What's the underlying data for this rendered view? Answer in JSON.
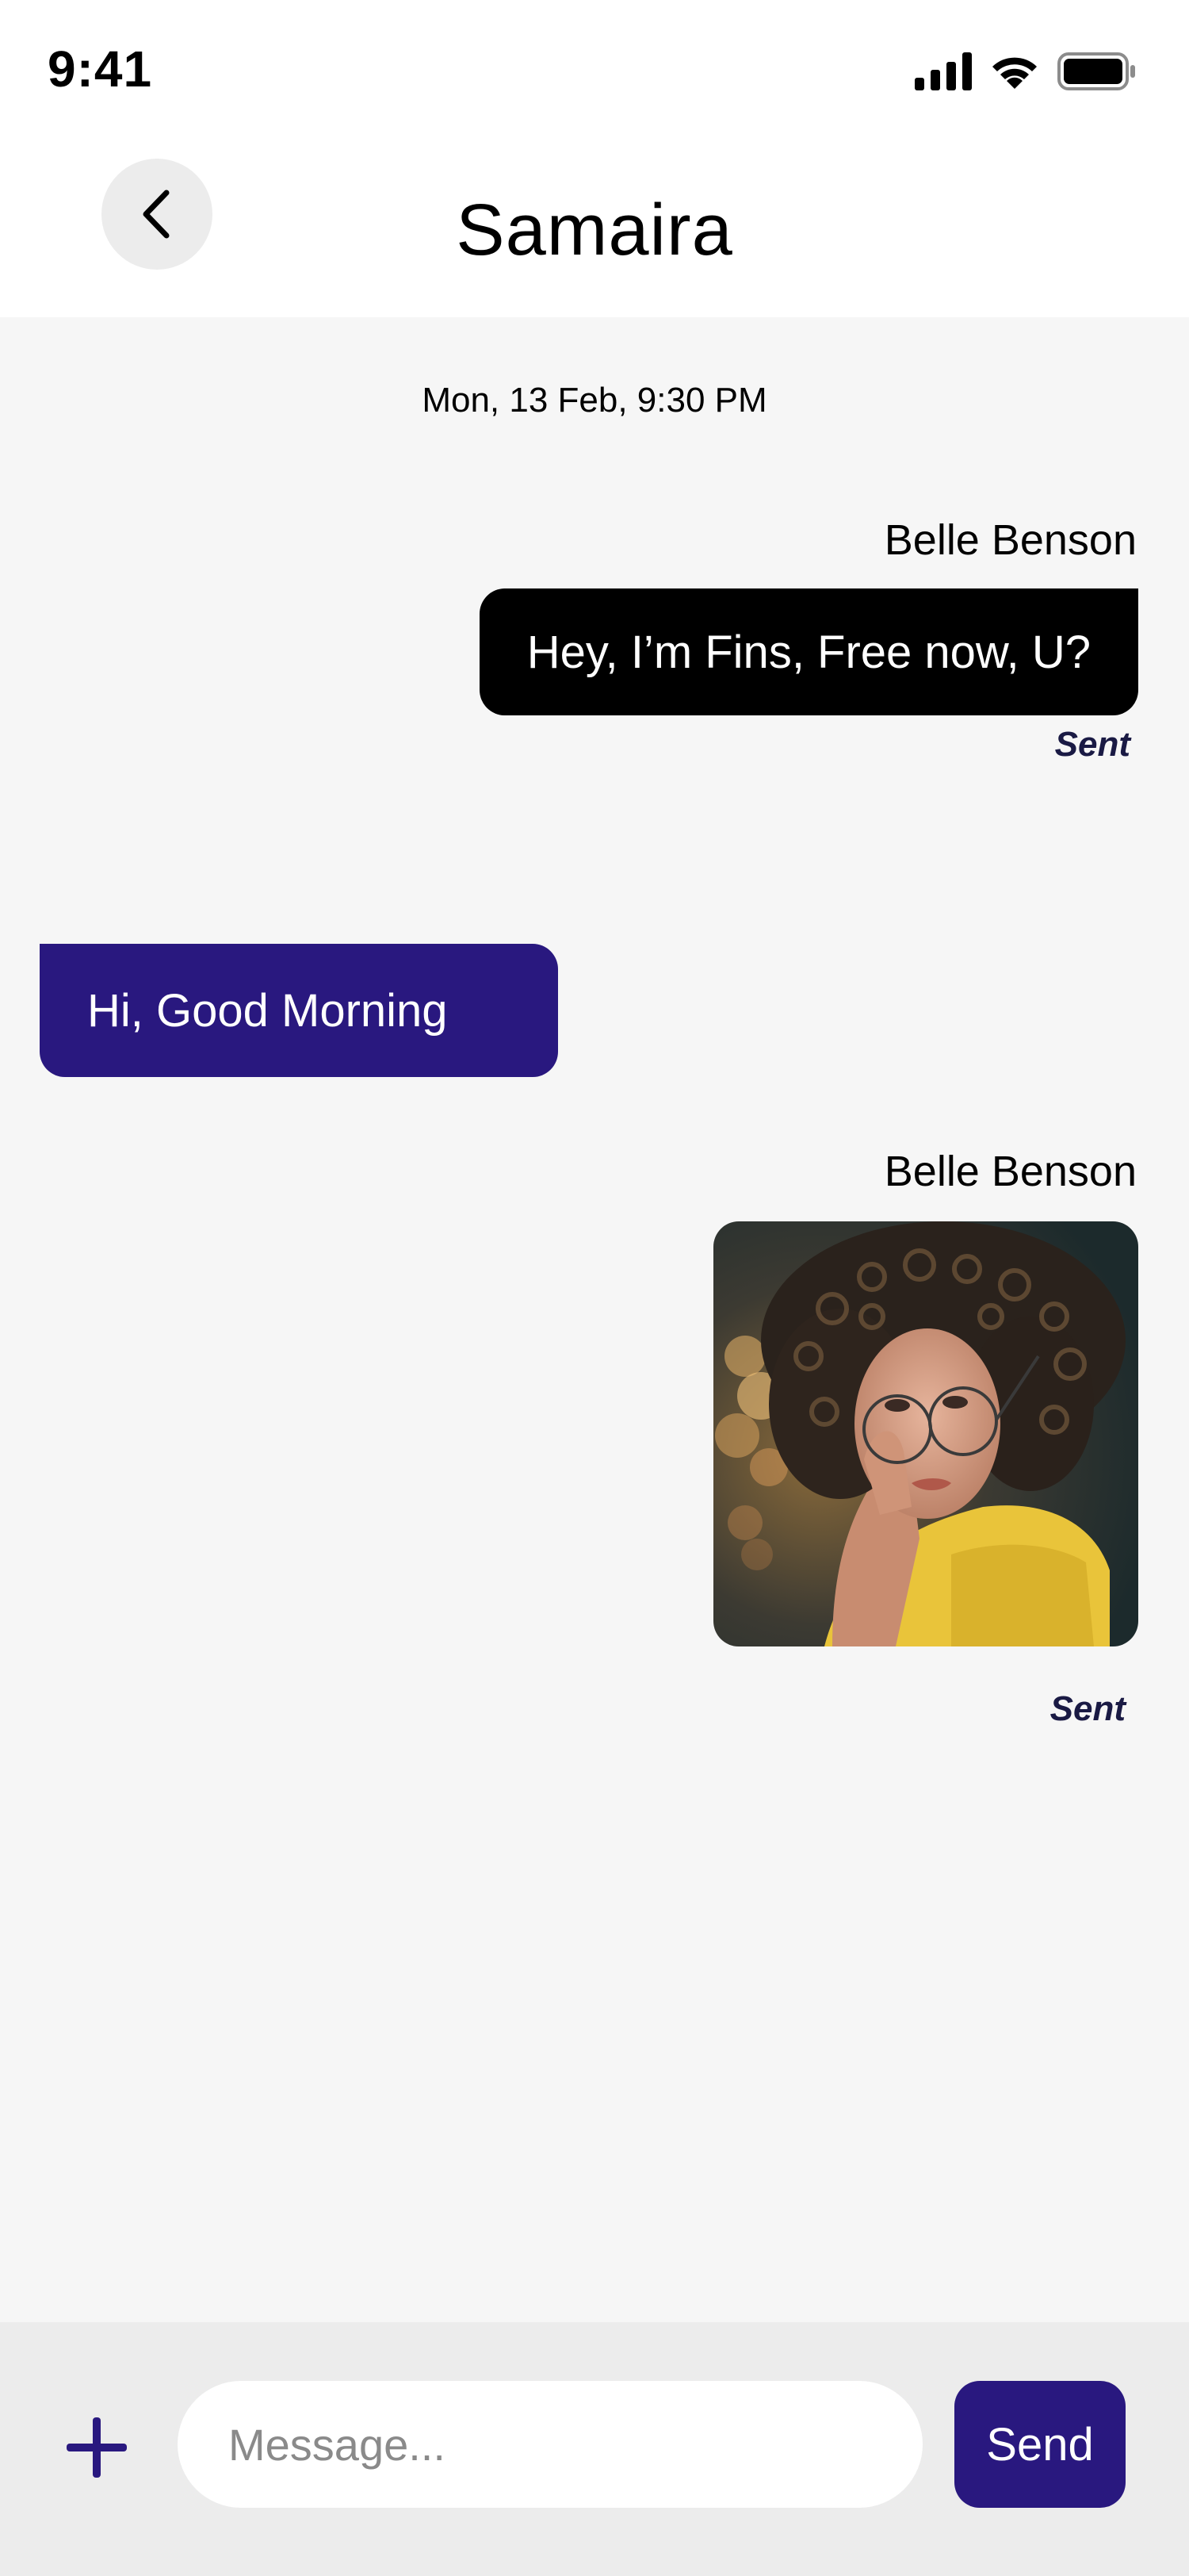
{
  "status_bar": {
    "time": "9:41",
    "icons": [
      "cellular-signal-icon",
      "wifi-icon",
      "battery-icon"
    ]
  },
  "header": {
    "title": "Samaira",
    "back_icon": "chevron-left-icon"
  },
  "chat": {
    "date_stamp": "Mon, 13 Feb, 9:30 PM",
    "messages": [
      {
        "direction": "outgoing",
        "sender": "Belle Benson",
        "text": "Hey, I’m Fins, Free now, U?",
        "status": "Sent"
      },
      {
        "direction": "incoming",
        "text": "Hi, Good Morning"
      },
      {
        "direction": "outgoing",
        "sender": "Belle Benson",
        "type": "image",
        "image_content": "portrait photo of a woman with curly hair, round glasses and yellow top",
        "status": "Sent"
      }
    ]
  },
  "composer": {
    "add_icon": "plus-icon",
    "placeholder": "Message...",
    "value": "",
    "send_label": "Send"
  },
  "colors": {
    "accent": "#29187f",
    "outgoing_bubble": "#000000",
    "background": "#f6f6f6",
    "composer_bar": "#ececec"
  }
}
